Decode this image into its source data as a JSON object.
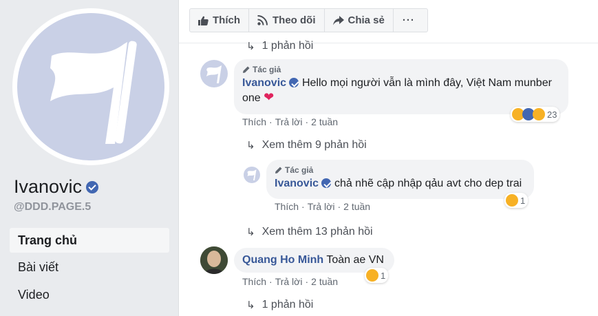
{
  "sidebar": {
    "page_name": "Ivanovic",
    "handle": "@DDD.PAGE.5",
    "nav": [
      "Trang chủ",
      "Bài viết",
      "Video"
    ]
  },
  "toolbar": {
    "like_label": "Thích",
    "follow_label": "Theo dõi",
    "share_label": "Chia sẻ",
    "more_label": "···"
  },
  "thread": {
    "top_replies": "1 phản hồi",
    "comments": [
      {
        "author_tag": "Tác giả",
        "author": "Ivanovic",
        "text": "Hello mọi người vẫn là mình đây, Việt Nam munber one",
        "text_line1": "Hello mọi người vẫn là mình đây, Việt Nam munber",
        "text_line2": "one",
        "reaction_count": "23",
        "like": "Thích",
        "reply": "Trả lời",
        "time": "2 tuần",
        "more_replies": "Xem thêm 9 phản hồi"
      },
      {
        "author_tag": "Tác giả",
        "author": "Ivanovic",
        "text": "chả nhẽ cập nhập qảu avt cho dep trai",
        "reaction_count": "1",
        "like": "Thích",
        "reply": "Trả lời",
        "time": "2 tuần",
        "more_replies": "Xem thêm 13 phản hồi"
      },
      {
        "author": "Quang Ho Minh",
        "text": "Toàn ae VN",
        "reaction_count": "1",
        "like": "Thích",
        "reply": "Trả lời",
        "time": "2 tuần",
        "replies": "1 phản hồi"
      }
    ]
  },
  "colors": {
    "brand": "#4267b2",
    "link": "#385898",
    "sidebar_bg": "#e9ebee"
  }
}
